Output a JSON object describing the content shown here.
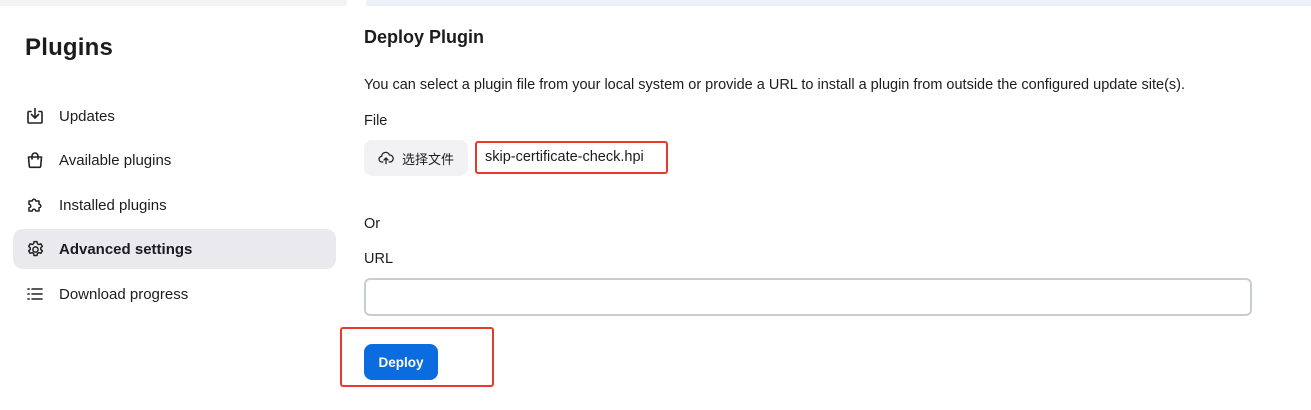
{
  "sidebar": {
    "title": "Plugins",
    "items": [
      {
        "label": "Updates",
        "icon": "download-icon",
        "active": false
      },
      {
        "label": "Available plugins",
        "icon": "shopping-bag-icon",
        "active": false
      },
      {
        "label": "Installed plugins",
        "icon": "puzzle-icon",
        "active": false
      },
      {
        "label": "Advanced settings",
        "icon": "gear-icon",
        "active": true
      },
      {
        "label": "Download progress",
        "icon": "list-icon",
        "active": false
      }
    ]
  },
  "main": {
    "title": "Deploy Plugin",
    "description": "You can select a plugin file from your local system or provide a URL to install a plugin from outside the configured update site(s).",
    "file_label": "File",
    "choose_file_label": "选择文件",
    "selected_file": "skip-certificate-check.hpi",
    "or_label": "Or",
    "url_label": "URL",
    "url_value": "",
    "deploy_label": "Deploy"
  },
  "colors": {
    "accent": "#0b6ce0",
    "highlight": "#e8392c",
    "active_nav_bg": "#eaeaee"
  }
}
